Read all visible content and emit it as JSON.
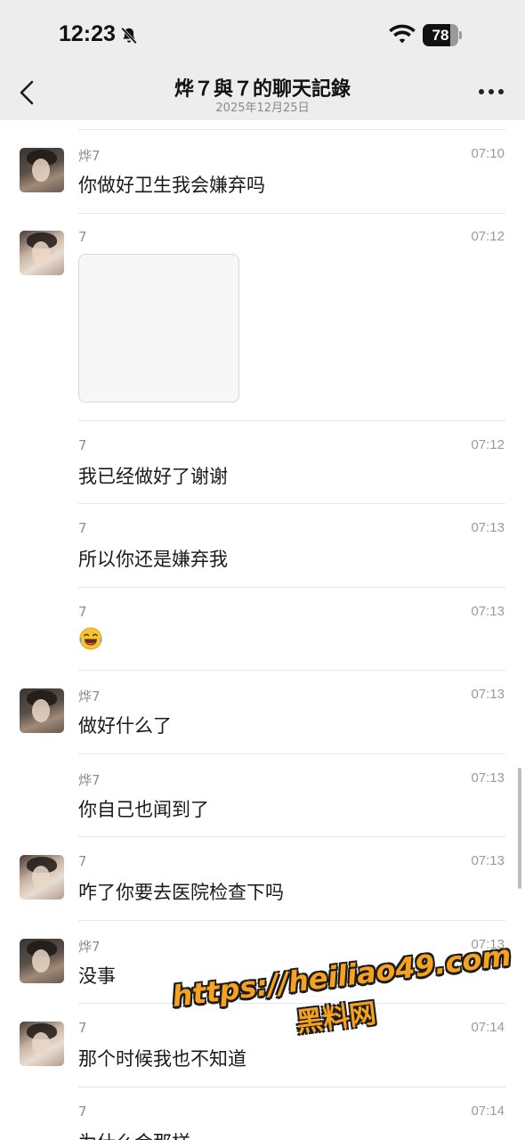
{
  "status_bar": {
    "time": "12:23",
    "battery": "78",
    "battery_level": 0.78
  },
  "nav": {
    "title": "烨７與７的聊天記錄",
    "date": "2025年12月25日"
  },
  "messages": [
    {
      "sender": "烨7",
      "time": "07:10",
      "text": "你做好卫生我会嫌弃吗"
    },
    {
      "sender": "7",
      "time": "07:12",
      "text": ""
    },
    {
      "sender": "7",
      "time": "07:12",
      "text": "我已经做好了谢谢"
    },
    {
      "sender": "7",
      "time": "07:13",
      "text": "所以你还是嫌弃我"
    },
    {
      "sender": "7",
      "time": "07:13",
      "text": "😂"
    },
    {
      "sender": "烨7",
      "time": "07:13",
      "text": "做好什么了"
    },
    {
      "sender": "烨7",
      "time": "07:13",
      "text": "你自己也闻到了"
    },
    {
      "sender": "7",
      "time": "07:13",
      "text": "咋了你要去医院检查下吗"
    },
    {
      "sender": "烨7",
      "time": "07:13",
      "text": "没事"
    },
    {
      "sender": "7",
      "time": "07:14",
      "text": "那个时候我也不知道"
    },
    {
      "sender": "7",
      "time": "07:14",
      "text": "为什么会那样"
    }
  ],
  "watermark": {
    "url": "https://heiliao49.com",
    "name": "黑料网"
  },
  "colors": {
    "nav_background": "#ededed",
    "watermark": "#f6a21e"
  }
}
